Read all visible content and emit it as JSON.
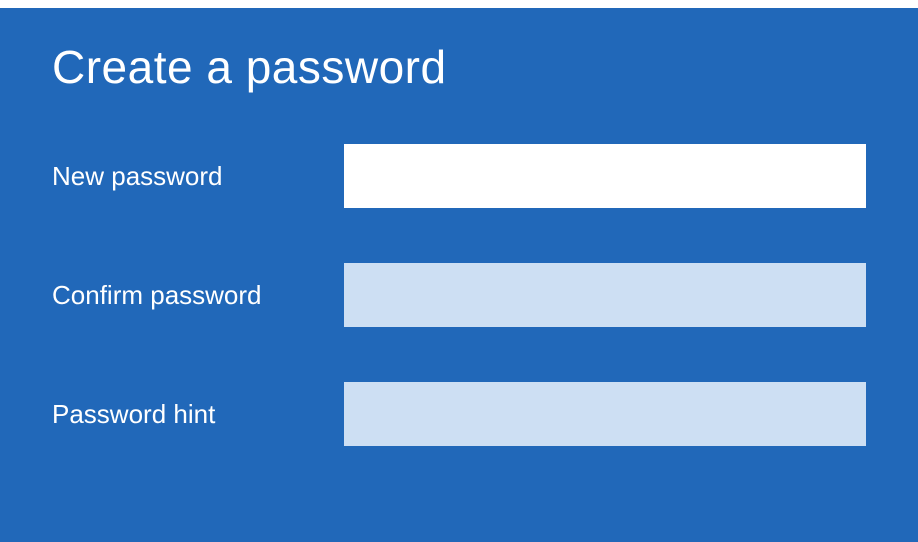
{
  "title": "Create a password",
  "fields": {
    "new_password": {
      "label": "New password",
      "value": ""
    },
    "confirm_password": {
      "label": "Confirm password",
      "value": ""
    },
    "password_hint": {
      "label": "Password hint",
      "value": ""
    }
  }
}
